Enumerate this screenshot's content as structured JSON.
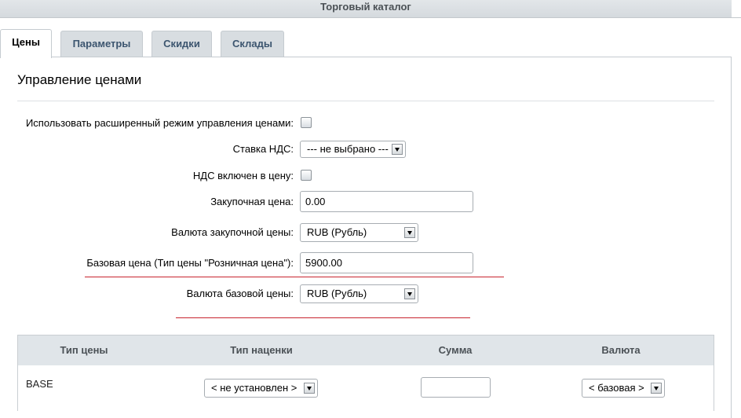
{
  "window": {
    "title": "Торговый каталог"
  },
  "tabs": [
    {
      "label": "Цены",
      "active": true
    },
    {
      "label": "Параметры",
      "active": false
    },
    {
      "label": "Скидки",
      "active": false
    },
    {
      "label": "Склады",
      "active": false
    }
  ],
  "section": {
    "title": "Управление ценами"
  },
  "form": {
    "extended_mode": {
      "label": "Использовать расширенный режим управления ценами:",
      "checked": false
    },
    "vat_rate": {
      "label": "Ставка НДС:",
      "value": "--- не выбрано ---"
    },
    "vat_included": {
      "label": "НДС включен в цену:",
      "checked": false
    },
    "purchase_price": {
      "label": "Закупочная цена:",
      "value": "0.00"
    },
    "purchase_currency": {
      "label": "Валюта закупочной цены:",
      "value": "RUB (Рубль)"
    },
    "base_price": {
      "label": "Базовая цена (Тип цены \"Розничная цена\"):",
      "value": "5900.00"
    },
    "base_currency": {
      "label": "Валюта базовой цены:",
      "value": "RUB (Рубль)"
    }
  },
  "table": {
    "headers": [
      "Тип цены",
      "Тип наценки",
      "Сумма",
      "Валюта"
    ],
    "rows": [
      {
        "price_type": "BASE",
        "markup_type": "< не установлен >",
        "amount": "",
        "currency": "< базовая >"
      }
    ]
  },
  "colors": {
    "accent_underline": "#c8252f",
    "tab_text": "#3c556f",
    "header_bg": "#d8dde1"
  }
}
